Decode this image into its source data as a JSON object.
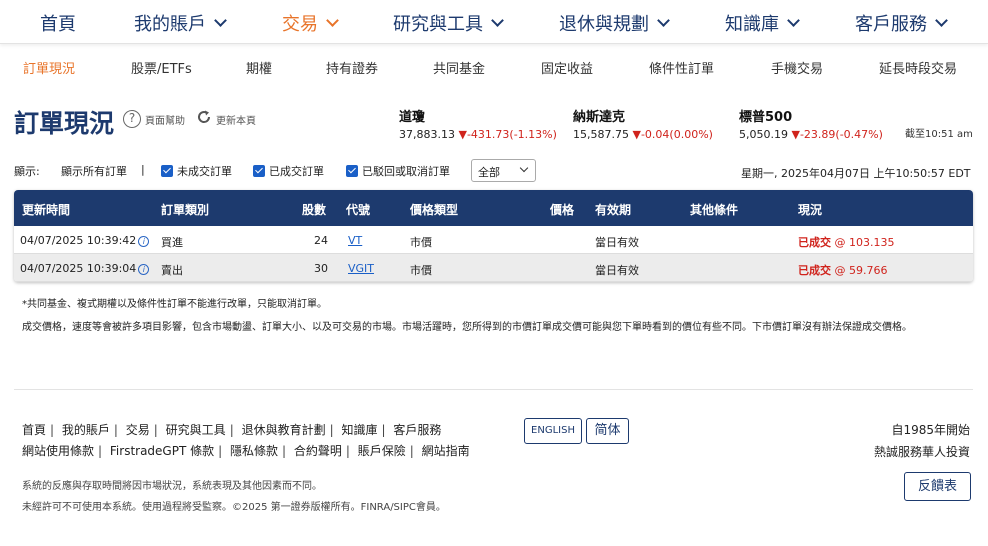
{
  "topnav": {
    "items": [
      {
        "label": "首頁"
      },
      {
        "label": "我的賬戶"
      },
      {
        "label": "交易"
      },
      {
        "label": "研究與工具"
      },
      {
        "label": "退休與規劃"
      },
      {
        "label": "知識庫"
      },
      {
        "label": "客戶服務"
      }
    ]
  },
  "subnav": {
    "items": [
      {
        "label": "訂單現況"
      },
      {
        "label": "股票/ETFs"
      },
      {
        "label": "期權"
      },
      {
        "label": "持有證券"
      },
      {
        "label": "共同基金"
      },
      {
        "label": "固定收益"
      },
      {
        "label": "條件性訂單"
      },
      {
        "label": "手機交易"
      },
      {
        "label": "延長時段交易"
      }
    ]
  },
  "page": {
    "title": "訂單現況",
    "help_label": "頁面幫助",
    "refresh_label": "更新本頁"
  },
  "indices": [
    {
      "name": "道瓊",
      "value": "37,883.13",
      "change": "▼-431.73(-1.13%)"
    },
    {
      "name": "納斯達克",
      "value": "15,587.75",
      "change": "▼-0.04(0.00%)"
    },
    {
      "name": "標普500",
      "value": "5,050.19",
      "change": "▼-23.89(-0.47%)"
    }
  ],
  "as_of": "截至10:51 am",
  "filters": {
    "show_label": "顯示:",
    "show_all": "顯示所有訂單",
    "pipe": "|",
    "open_orders": "未成交訂單",
    "filled_orders": "已成交訂單",
    "rejected_orders": "已駁回或取消訂單",
    "select_value": "全部"
  },
  "date_line": "星期一, 2025年04月07日 上午10:50:57 EDT",
  "table": {
    "headers": [
      "更新時間",
      "訂單類別",
      "股數",
      "代號",
      "價格類型",
      "價格",
      "有效期",
      "其他條件",
      "現況"
    ],
    "rows": [
      {
        "time": "04/07/2025 10:39:42",
        "info": "i",
        "type": "買進",
        "qty": "24",
        "symbol": "VT",
        "price_type": "市價",
        "price": "",
        "duration": "當日有效",
        "conditions": "",
        "status": "已成交",
        "status_price": "@ 103.135"
      },
      {
        "time": "04/07/2025 10:39:04",
        "info": "i",
        "type": "賣出",
        "qty": "30",
        "symbol": "VGIT",
        "price_type": "市價",
        "price": "",
        "duration": "當日有效",
        "conditions": "",
        "status": "已成交",
        "status_price": "@ 59.766"
      }
    ]
  },
  "notes": {
    "note1": "*共同基金、複式期權以及條件性訂單不能進行改單，只能取消訂單。",
    "note2": "成交價格，速度等會被許多項目影響，包含市場動盪、訂單大小、以及可交易的市場。市場活躍時，您所得到的市價訂單成交價可能與您下單時看到的價位有些不同。下市價訂單沒有辦法保證成交價格。"
  },
  "footer": {
    "links_row1": [
      "首頁",
      "我的賬戶",
      "交易",
      "研究與工具",
      "退休與教育計劃",
      "知識庫",
      "客戶服務"
    ],
    "links_row2": [
      "網站使用條款",
      "FirstradeGPT 條款",
      "隱私條款",
      "合約聲明",
      "賬戶保險",
      "網站指南"
    ],
    "lang_english": "ENGLISH",
    "lang_simplified": "简体",
    "since_line1": "自1985年開始",
    "since_line2": "熱誠服務華人投資",
    "legal1": "系統的反應與存取時間將因市場狀況，系統表現及其他因素而不同。",
    "legal2": "未經許可不可使用本系統。使用過程將受監察。©2025 第一證券版權所有。FINRA/SIPC會員。",
    "feedback": "反饋表"
  }
}
